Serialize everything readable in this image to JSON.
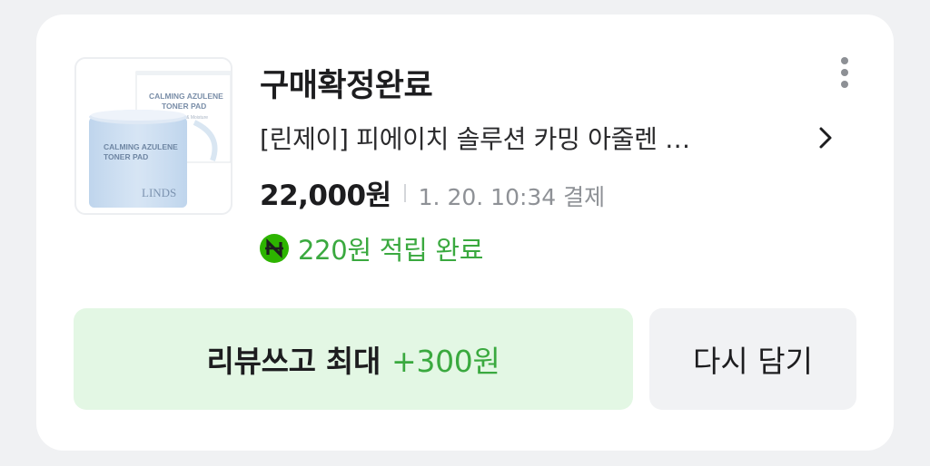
{
  "order": {
    "status": "구매확정완료",
    "product_title": "[린제이] 피에이치 솔루션 카밍 아줄렌 …",
    "price": "22,000원",
    "paid_at": "1. 20. 10:34 결제",
    "points_text": "220원 적립 완료",
    "points_badge_glyph": "N"
  },
  "thumbnail": {
    "box_line1": "CALMING AZULENE",
    "box_line2": "TONER PAD",
    "box_sub": "Soothing & Moisture",
    "jar_line1": "CALMING AZULENE",
    "jar_line2": "TONER PAD",
    "jar_brand": "LINDS"
  },
  "actions": {
    "review_label": "리뷰쓰고 최대",
    "review_bonus": "+300원",
    "rebuy_label": "다시 담기"
  },
  "colors": {
    "accent_green": "#3aa93f",
    "npay_green": "#2db400",
    "review_bg": "#e3f7e4",
    "secondary_bg": "#f1f2f4"
  },
  "icons": {
    "more": "more-vertical-icon",
    "chevron": "chevron-right-icon",
    "points": "npay-points-icon"
  }
}
